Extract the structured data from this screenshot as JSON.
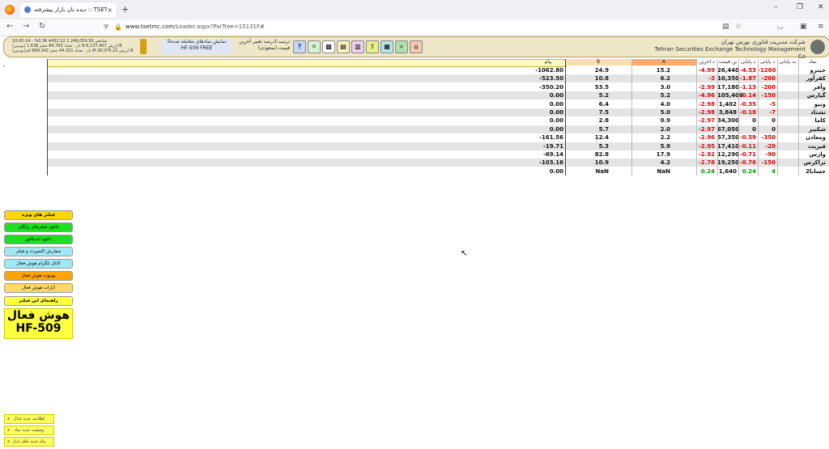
{
  "browser": {
    "tab_title": "دیده بان بازار پیشرفته :: TSETMC",
    "new_tab": "+",
    "close_tab": "×",
    "url_host": "www.tsetmc.com",
    "url_path": "/Loader.aspx?ParTree=15131F#",
    "win_min": "–",
    "win_max": "❐",
    "win_close": "✕",
    "back": "←",
    "forward": "→",
    "reload": "↻"
  },
  "header": {
    "company_fa": "شرکت مدیریت فناوری بورس تهران",
    "company_en": "Tehran Securities Exchange Technology Management Co",
    "sort_line1": "ترتیب:(درصد تغییر آخرین",
    "sort_line2": "قیمت (صعودی)",
    "show_line1": "5نمایش نمادهای معامله شده",
    "show_line2": "HF-509 FREE",
    "market_lines": [
      "10:05:14 - %0.36 4432.12 1,249,059.50 شاخص",
      "(بورس) بار - تعداد 84,793 حجم 1.638 B ارزش 6,137.467 B",
      "(فرابورس) بار - تعداد 44,331 حجم 869.342 M ارزش 26,076.22 B"
    ]
  },
  "table": {
    "headers": {
      "symbol": "نماد",
      "last_change": "ت پایانی",
      "last_pct": "د پایانی",
      "close_pct": "د پایانی",
      "last_price": "ین قیمت",
      "close_chg": "د آخرین",
      "a": "A",
      "b": "B",
      "msg": "پیام"
    },
    "rows": [
      {
        "symbol": "حپترو",
        "c1": "-1260",
        "c2": "-4.53",
        "c3": "26,440",
        "c4": "-4.99",
        "a": "15.2",
        "b": "24.9",
        "msg": "-1062.80"
      },
      {
        "symbol": "کفرآور",
        "c1": "-200",
        "c2": "-1.87",
        "c3": "10,350",
        "c4": "-3",
        "a": "6.2",
        "b": "10.8",
        "msg": "-523.50"
      },
      {
        "symbol": "وآفر",
        "c1": "-200",
        "c2": "-1.13",
        "c3": "17,180",
        "c4": "-2.99",
        "a": "3.0",
        "b": "53.5",
        "msg": "-350.20"
      },
      {
        "symbol": "گپارس",
        "c1": "-150",
        "c2": "-0.14",
        "c3": "105,400",
        "c4": "-4.96",
        "a": "5.2",
        "b": "5.2",
        "msg": "0.00"
      },
      {
        "symbol": "وتپو",
        "c1": "-5",
        "c2": "-0.35",
        "c3": "1,402",
        "c4": "-2.98",
        "a": "4.0",
        "b": "6.4",
        "msg": "0.00"
      },
      {
        "symbol": "تشتاد",
        "c1": "-7",
        "c2": "-0.18",
        "c3": "3,848",
        "c4": "-2.98",
        "a": "5.0",
        "b": "7.5",
        "msg": "0.00"
      },
      {
        "symbol": "کاما",
        "c1": "0",
        "c2": "0",
        "c3": "34,300",
        "c4": "-2.97",
        "a": "0.9",
        "b": "2.8",
        "msg": "0.00"
      },
      {
        "symbol": "شکبیر",
        "c1": "0",
        "c2": "0",
        "c3": "67,050",
        "c4": "-2.97",
        "a": "2.0",
        "b": "5.7",
        "msg": "0.00"
      },
      {
        "symbol": "ومعادن",
        "c1": "-350",
        "c2": "-0.59",
        "c3": "57,350",
        "c4": "-2.96",
        "a": "2.2",
        "b": "12.4",
        "msg": "-161.56"
      },
      {
        "symbol": "قیرپت",
        "c1": "-20",
        "c2": "-0.11",
        "c3": "17,410",
        "c4": "-2.95",
        "a": "5.9",
        "b": "5.3",
        "msg": "-19.71"
      },
      {
        "symbol": "وارس",
        "c1": "-90",
        "c2": "-0.71",
        "c3": "12,290",
        "c4": "-2.92",
        "a": "17.9",
        "b": "82.8",
        "msg": "-69.14"
      },
      {
        "symbol": "تراکرس",
        "c1": "-150",
        "c2": "-0.76",
        "c3": "19,250",
        "c4": "-2.78",
        "a": "4.2",
        "b": "10.9",
        "msg": "-103.16"
      },
      {
        "symbol": "حسابا2",
        "c1": "4",
        "c2": "0.24",
        "c3": "1,640",
        "c4": "0.24",
        "a": "NaN",
        "b": "NaN",
        "msg": "0.00"
      }
    ]
  },
  "left_buttons": [
    {
      "label": "فیلتر های ویژه",
      "bg": "#ffd700"
    },
    {
      "label": "دانلود فیلترهای رایگان",
      "bg": "#22dd22"
    },
    {
      "label": "دانلود اندیکاتور",
      "bg": "#22dd22"
    },
    {
      "label": "سفارش اکسپرت و فیلتر",
      "bg": "#9fe8f5"
    },
    {
      "label": "کانال تلگرام هوش فعال",
      "bg": "#9fe8f5"
    },
    {
      "label": "یوتیوب هوش فعال",
      "bg": "#ffa500"
    },
    {
      "label": "آپارات هوش فعال",
      "bg": "#ffd966"
    },
    {
      "label": "راهنمای این فیلتر",
      "bg": "#ffff40"
    }
  ],
  "big_button": {
    "line1": "هوش فعال",
    "line2": "HF-509"
  },
  "notices": [
    {
      "label": "اطلاعیه جدید کدال",
      "close": "x"
    },
    {
      "label": "وضعیت جدید نماد",
      "close": "x"
    },
    {
      "label": "پیام جدید ناظر بازار",
      "close": "x"
    }
  ]
}
